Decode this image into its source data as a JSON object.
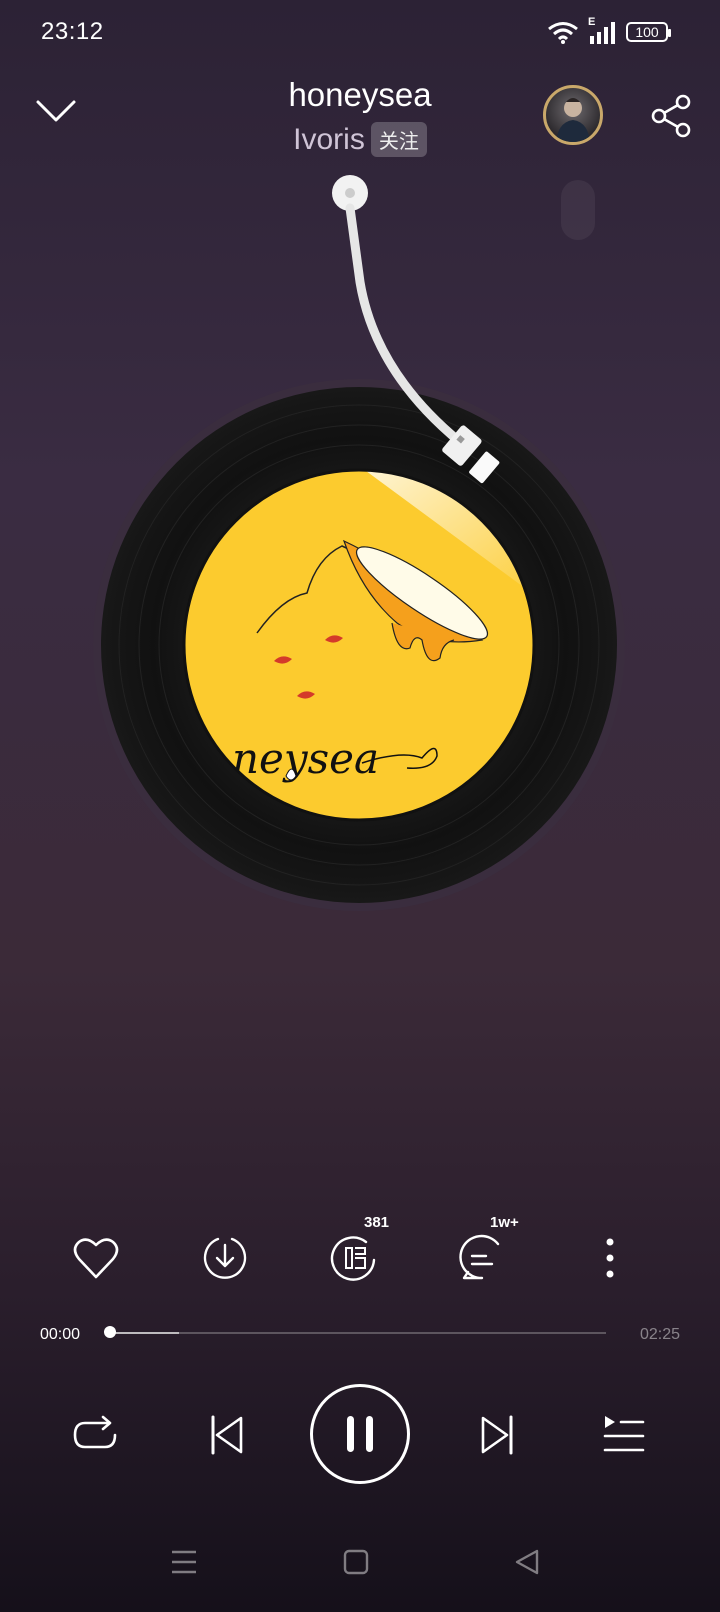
{
  "status_bar": {
    "time": "23:12",
    "network": "E",
    "battery": "100"
  },
  "header": {
    "title": "honeysea",
    "artist": "Ivoris",
    "follow_label": "关注"
  },
  "album_art": {
    "text": "neysea",
    "background_color": "#fccb2e",
    "accent_color": "#f5a01c"
  },
  "actions": {
    "like": "heart-icon",
    "download": "download-icon",
    "karaoke_count": "381",
    "comments_count": "1w+",
    "more": "more-icon"
  },
  "progress": {
    "current": "00:00",
    "total": "02:25",
    "played_fraction": 0.0,
    "buffered_fraction": 0.14
  },
  "controls": {
    "repeat": "repeat-icon",
    "previous": "previous-icon",
    "pause": "pause-icon",
    "next": "next-icon",
    "playlist": "playlist-icon"
  }
}
